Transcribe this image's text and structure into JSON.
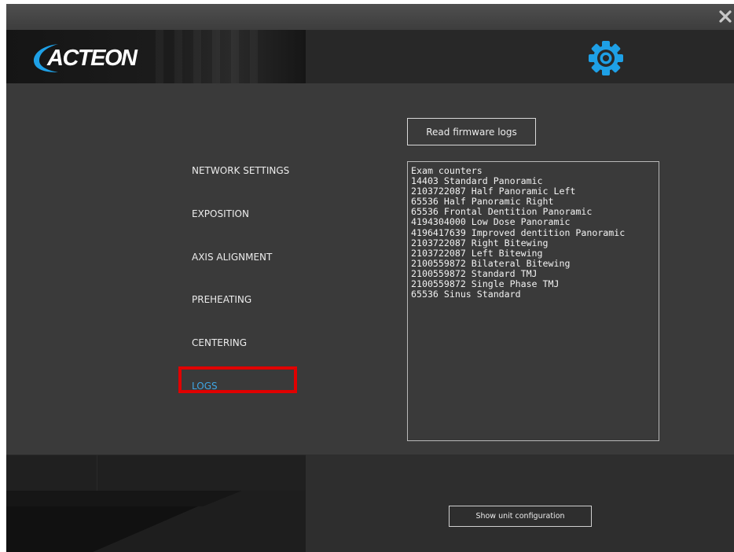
{
  "header": {
    "logo_text": "ACTEON",
    "icons": {
      "close": "close-icon",
      "settings": "gear-icon"
    },
    "accent_color": "#1ea0e6"
  },
  "nav": {
    "items": [
      {
        "label": "NETWORK SETTINGS",
        "active": false
      },
      {
        "label": "EXPOSITION",
        "active": false
      },
      {
        "label": "AXIS ALIGNMENT",
        "active": false
      },
      {
        "label": "PREHEATING",
        "active": false
      },
      {
        "label": "CENTERING",
        "active": false
      },
      {
        "label": "LOGS",
        "active": true
      }
    ],
    "active_color": "#3fa6e4",
    "highlight_color": "#e00000"
  },
  "logs": {
    "read_button_label": "Read firmware logs",
    "lines": [
      "Exam counters",
      "14403 Standard Panoramic",
      "2103722087 Half Panoramic Left",
      "65536 Half Panoramic Right",
      "65536 Frontal Dentition Panoramic",
      "4194304000 Low Dose Panoramic",
      "4196417639 Improved dentition Panoramic",
      "2103722087 Right Bitewing",
      "2103722087 Left Bitewing",
      "2100559872 Bilateral Bitewing",
      "2100559872 Standard TMJ",
      "2100559872 Single Phase TMJ",
      "65536 Sinus Standard"
    ]
  },
  "footer": {
    "config_button_label": "Show unit configuration"
  }
}
